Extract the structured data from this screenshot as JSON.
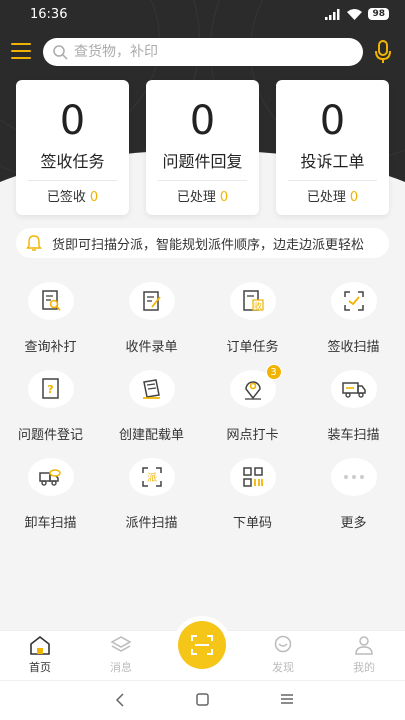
{
  "status_bar": {
    "time": "16:36",
    "battery": "98"
  },
  "search": {
    "placeholder": "查货物，补印"
  },
  "cards": [
    {
      "count": "0",
      "title": "签收任务",
      "sub_label": "已签收",
      "sub_count": "0"
    },
    {
      "count": "0",
      "title": "问题件回复",
      "sub_label": "已处理",
      "sub_count": "0"
    },
    {
      "count": "0",
      "title": "投诉工单",
      "sub_label": "已处理",
      "sub_count": "0"
    }
  ],
  "notice": {
    "text": "货即可扫描分派，智能规划派件顺序，边走边派更轻松"
  },
  "grid": [
    {
      "label": "查询补打",
      "icon": "search-print-icon"
    },
    {
      "label": "收件录单",
      "icon": "receive-entry-icon"
    },
    {
      "label": "订单任务",
      "icon": "order-task-icon",
      "glyph": "收"
    },
    {
      "label": "签收扫描",
      "icon": "sign-scan-icon"
    },
    {
      "label": "问题件登记",
      "icon": "problem-register-icon",
      "glyph": "?"
    },
    {
      "label": "创建配载单",
      "icon": "create-load-icon"
    },
    {
      "label": "网点打卡",
      "icon": "checkin-location-icon",
      "badge": "3"
    },
    {
      "label": "装车扫描",
      "icon": "loading-truck-icon"
    },
    {
      "label": "卸车扫描",
      "icon": "unloading-truck-icon"
    },
    {
      "label": "派件扫描",
      "icon": "dispatch-scan-icon",
      "glyph": "派"
    },
    {
      "label": "下单码",
      "icon": "order-code-icon"
    },
    {
      "label": "更多",
      "icon": "more-icon"
    }
  ],
  "nav": {
    "home": "首页",
    "messages": "消息",
    "discover": "发现",
    "mine": "我的"
  },
  "colors": {
    "accent": "#f0b400",
    "header": "#2b2b2b",
    "scan": "#f5c518"
  }
}
